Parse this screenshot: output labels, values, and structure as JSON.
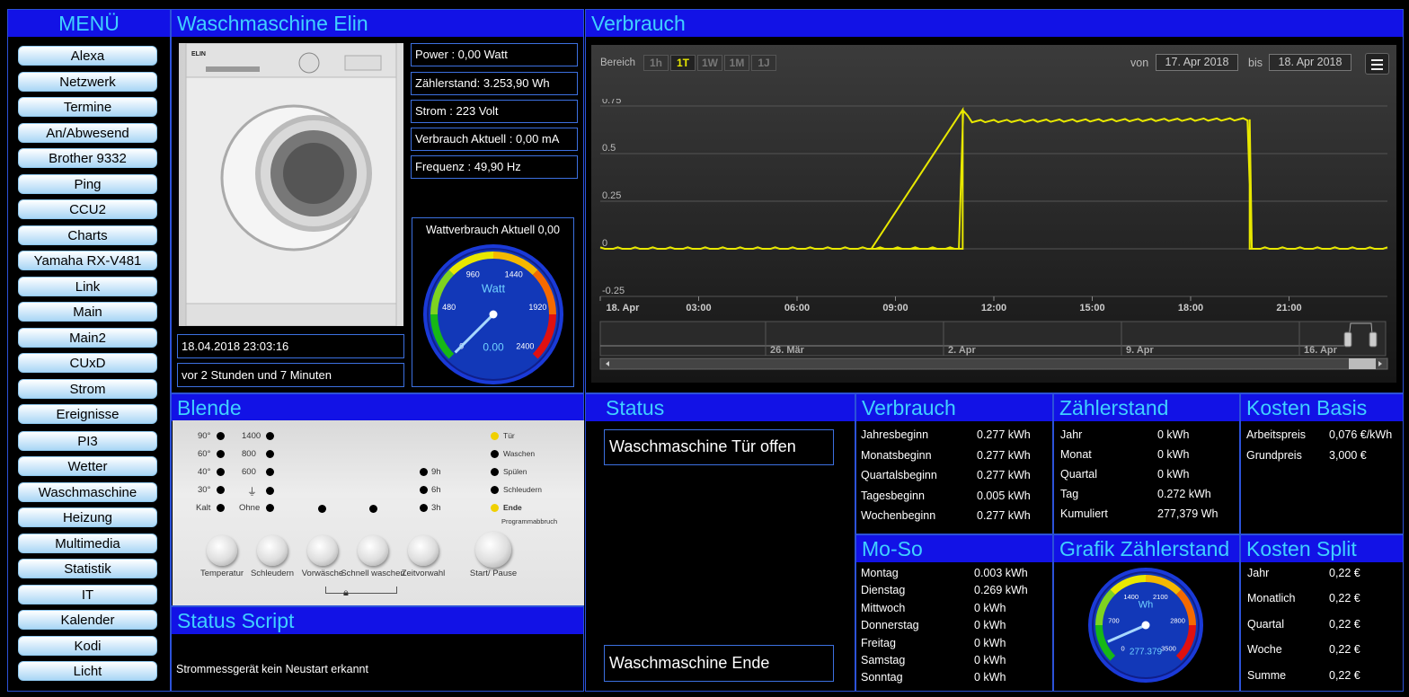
{
  "menu": {
    "title": "MENÜ",
    "items": [
      "Alexa",
      "Netzwerk",
      "Termine",
      "An/Abwesend",
      "Brother 9332",
      "Ping",
      "CCU2",
      "Charts",
      "Yamaha RX-V481",
      "Link",
      "Main",
      "Main2",
      "CUxD",
      "Strom",
      "Ereignisse",
      "PI3",
      "Wetter",
      "Waschmaschine",
      "Heizung",
      "Multimedia",
      "Statistik",
      "IT",
      "Kalender",
      "Kodi",
      "Licht"
    ]
  },
  "washer": {
    "title": "Waschmaschine Elin",
    "power": "Power : 0,00 Watt",
    "counter": "Zählerstand: 3.253,90 Wh",
    "voltage": "Strom : 223 Volt",
    "current": "Verbrauch Aktuell : 0,00 mA",
    "frequency": "Frequenz : 49,90 Hz",
    "timestamp": "18.04.2018 23:03:16",
    "ago": "vor 2 Stunden und 7 Minuten",
    "brand": "ELIN",
    "gauge": {
      "title": "Wattverbrauch Aktuell 0,00",
      "unit": "Watt",
      "value": "0.00",
      "value_num": 0,
      "max": 2400,
      "ticks": [
        "0",
        "480",
        "960",
        "1440",
        "1920",
        "2400"
      ]
    }
  },
  "verbrauch_chart": {
    "title": "Verbrauch",
    "range_label": "Bereich",
    "range_buttons": [
      "1h",
      "1T",
      "1W",
      "1M",
      "1J"
    ],
    "range_selected": "1T",
    "from_label": "von",
    "from": "17. Apr 2018",
    "to_label": "bis",
    "to": "18. Apr 2018",
    "menu_icon": "hamburger-menu-icon",
    "nav_labels": [
      "26. Mär",
      "2. Apr",
      "9. Apr",
      "16. Apr"
    ],
    "scroll_icon": "scrollbar-grip-icon"
  },
  "chart_data": {
    "type": "line",
    "x_ticks": [
      "18. Apr",
      "03:00",
      "06:00",
      "09:00",
      "12:00",
      "15:00",
      "18:00",
      "21:00"
    ],
    "y_ticks": [
      "0.75",
      "0.5",
      "0.25",
      "0",
      "-0.25"
    ],
    "ylim": [
      -0.25,
      0.75
    ],
    "xlim_hours": [
      0,
      24
    ],
    "x_hours": [
      0,
      11.05,
      11.05,
      11.3,
      19.8,
      19.8,
      24
    ],
    "values": [
      0,
      0,
      0.73,
      0.67,
      0.68,
      0,
      0
    ],
    "color": "#e8e800"
  },
  "blende": {
    "title": "Blende",
    "temp_labels": [
      "90°",
      "60°",
      "40°",
      "30°",
      "Kalt"
    ],
    "spin_labels": [
      "1400",
      "800",
      "600",
      "Ohne"
    ],
    "time_labels": [
      "9h",
      "6h",
      "3h"
    ],
    "status_labels": [
      "Tür",
      "Waschen",
      "Spülen",
      "Schleudern",
      "Ende"
    ],
    "abort_label": "Programmabbruch",
    "knob_labels": [
      "Temperatur",
      "Schleudern",
      "Vorwäsche",
      "Schnell waschen",
      "Zeitvorwahl",
      "Start/ Pause"
    ],
    "lock_icon": "child-lock-icon"
  },
  "status_script": {
    "title": "Status Script",
    "message": "Strommessgerät kein Neustart erkannt"
  },
  "status": {
    "title": "Status",
    "door": "Waschmaschine Tür offen",
    "end": "Waschmaschine Ende"
  },
  "verbrauch_table": {
    "title": "Verbrauch",
    "rows": [
      [
        "Jahresbeginn",
        "0.277 kWh"
      ],
      [
        "Monatsbeginn",
        "0.277 kWh"
      ],
      [
        "Quartalsbeginn",
        "0.277 kWh"
      ],
      [
        "Tagesbeginn",
        "0.005 kWh"
      ],
      [
        "Wochenbeginn",
        "0.277 kWh"
      ]
    ]
  },
  "zaehlerstand": {
    "title": "Zählerstand",
    "rows": [
      [
        "Jahr",
        "0 kWh"
      ],
      [
        "Monat",
        "0 kWh"
      ],
      [
        "Quartal",
        "0 kWh"
      ],
      [
        "Tag",
        "0.272 kWh"
      ],
      [
        "Kumuliert",
        "277,379 Wh"
      ]
    ]
  },
  "kosten_basis": {
    "title": "Kosten Basis",
    "rows": [
      [
        "Arbeitspreis",
        "0,076 €/kWh"
      ],
      [
        "Grundpreis",
        "3,000 €"
      ]
    ]
  },
  "moso": {
    "title": "Mo-So",
    "rows": [
      [
        "Montag",
        "0.003 kWh"
      ],
      [
        "Dienstag",
        "0.269 kWh"
      ],
      [
        "Mittwoch",
        "0 kWh"
      ],
      [
        "Donnerstag",
        "0 kWh"
      ],
      [
        "Freitag",
        "0 kWh"
      ],
      [
        "Samstag",
        "0 kWh"
      ],
      [
        "Sonntag",
        "0 kWh"
      ]
    ]
  },
  "grafik": {
    "title": "Grafik Zählerstand",
    "unit": "Wh",
    "value": "277.379",
    "value_num": 277.379,
    "max": 3500,
    "ticks": [
      "0",
      "700",
      "1400",
      "2100",
      "2800",
      "3500"
    ]
  },
  "kosten_split": {
    "title": "Kosten Split",
    "rows": [
      [
        "Jahr",
        "0,22 €"
      ],
      [
        "Monatlich",
        "0,22 €"
      ],
      [
        "Quartal",
        "0,22 €"
      ],
      [
        "Woche",
        "0,22 €"
      ],
      [
        "Summe",
        "0,22 €"
      ]
    ]
  },
  "colors": {
    "header_bg": "#1212e6",
    "header_text": "#40d0ff",
    "border": "#2c52d8",
    "line": "#e8e800"
  }
}
